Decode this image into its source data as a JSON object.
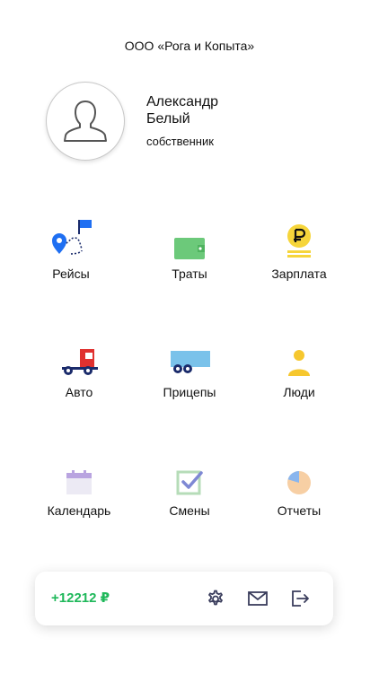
{
  "company": "ООО «Рога и Копыта»",
  "user": {
    "first_name": "Александр",
    "last_name": "Белый",
    "role": "собственник"
  },
  "menu": [
    {
      "label": "Рейсы",
      "icon": "route-icon",
      "muted": false
    },
    {
      "label": "Траты",
      "icon": "wallet-icon",
      "muted": false
    },
    {
      "label": "Зарплата",
      "icon": "ruble-coins-icon",
      "muted": false
    },
    {
      "label": "Авто",
      "icon": "truck-icon",
      "muted": false
    },
    {
      "label": "Прицепы",
      "icon": "trailer-icon",
      "muted": false
    },
    {
      "label": "Люди",
      "icon": "person-icon",
      "muted": false
    },
    {
      "label": "Календарь",
      "icon": "calendar-icon",
      "muted": true
    },
    {
      "label": "Смены",
      "icon": "checkbox-icon",
      "muted": true
    },
    {
      "label": "Отчеты",
      "icon": "pie-chart-icon",
      "muted": true
    }
  ],
  "bottom_bar": {
    "balance": "+12212 ₽",
    "icons": [
      "gear-icon",
      "mail-icon",
      "logout-icon"
    ]
  },
  "colors": {
    "balance": "#1fb85a",
    "muted_label": "#8c8c8c",
    "toolbar_icon": "#3a3d5c"
  }
}
